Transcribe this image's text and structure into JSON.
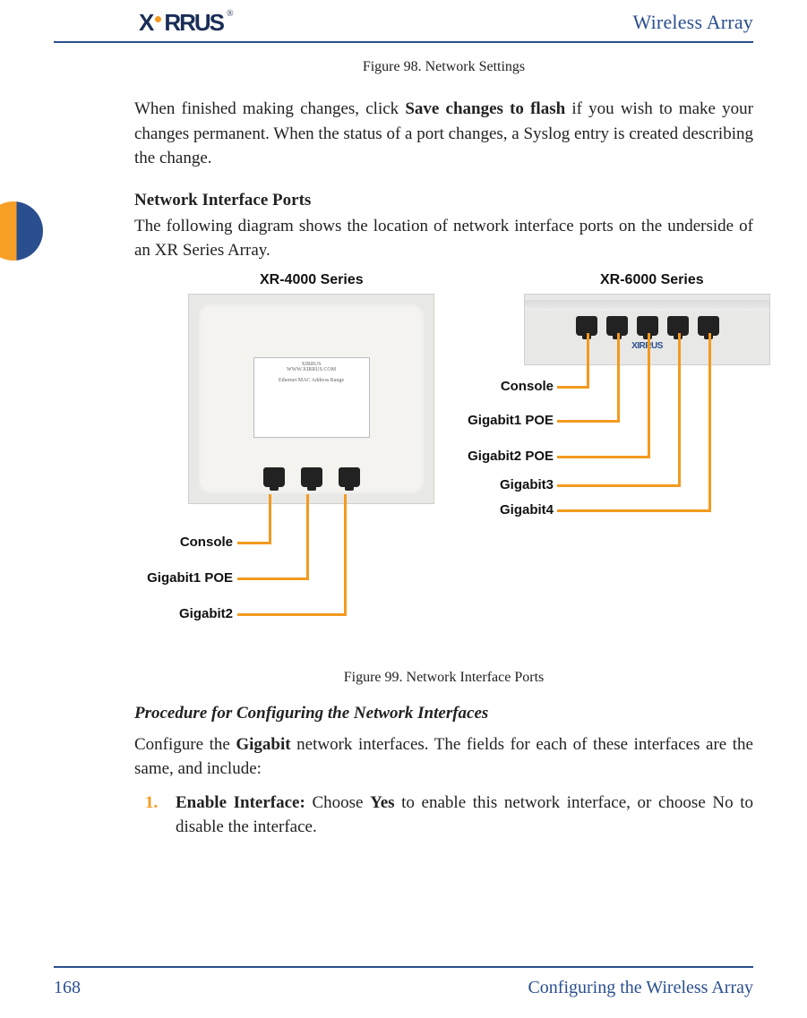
{
  "header": {
    "product": "Wireless Array",
    "logo_text": "XIRRUS"
  },
  "figure98_caption": "Figure 98. Network Settings",
  "para1_pre": "When finished making changes, click ",
  "para1_bold": "Save changes to flash",
  "para1_post": " if you wish to make your changes permanent. When the status of a port changes, a Syslog entry is created describing the change.",
  "section1_heading": "Network Interface Ports",
  "section1_para": "The following diagram shows the location of network interface ports on the underside of an XR Series Array.",
  "diagram": {
    "left_series": "XR-4000 Series",
    "right_series": "XR-6000 Series",
    "left_labels": {
      "console": "Console",
      "gig1": "Gigabit1 POE",
      "gig2": "Gigabit2"
    },
    "right_labels": {
      "console": "Console",
      "gig1": "Gigabit1 POE",
      "gig2": "Gigabit2 POE",
      "gig3": "Gigabit3",
      "gig4": "Gigabit4"
    }
  },
  "figure99_caption": "Figure 99. Network Interface Ports",
  "procedure_heading": "Procedure for Configuring the Network Interfaces",
  "procedure_para_pre": "Configure the ",
  "procedure_para_bold": "Gigabit",
  "procedure_para_post": " network interfaces. The fields for each of these interfaces are the same, and include:",
  "list": {
    "num1": "1.",
    "item1_bold": "Enable Interface:",
    "item1_mid": " Choose ",
    "item1_bold2": "Yes",
    "item1_post": " to enable this network interface, or choose No to disable the interface."
  },
  "footer": {
    "page": "168",
    "section": "Configuring the Wireless Array"
  }
}
